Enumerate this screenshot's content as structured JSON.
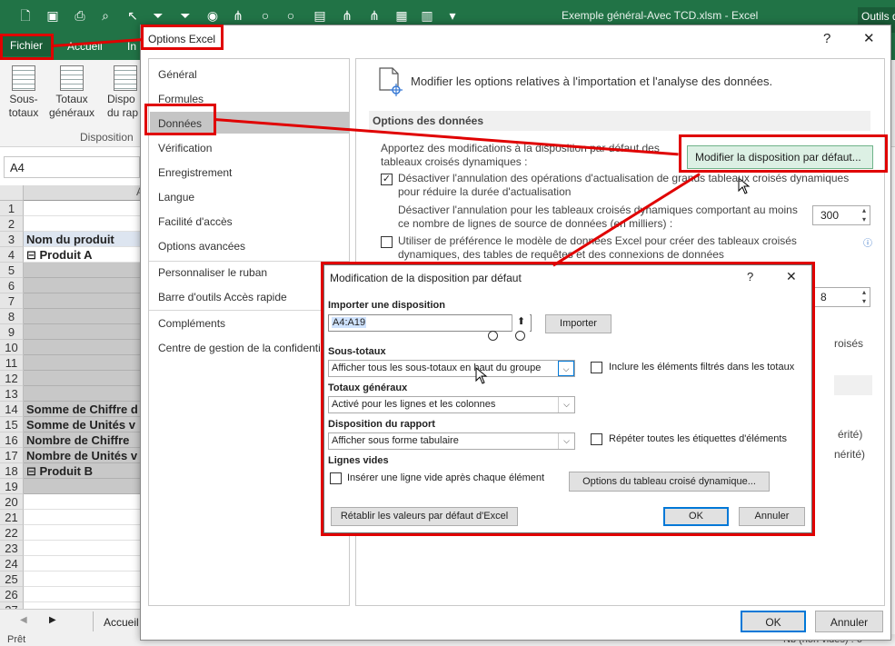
{
  "excel": {
    "window_title": "Exemple général-Avec TCD.xlsm  -  Excel",
    "tools_tab": "Outils de",
    "tabs": [
      "Fichier",
      "Accueil",
      "In"
    ],
    "ribbon": {
      "sous_totaux": "Sous-\ntotaux",
      "totaux_generaux": "Totaux\ngénéraux",
      "dispo": "Dispo\ndu rap",
      "group_label": "Disposition"
    },
    "name_box": "A4",
    "column_header": "A",
    "rows": [
      {
        "n": "1",
        "text": "",
        "style": ""
      },
      {
        "n": "2",
        "text": "",
        "style": ""
      },
      {
        "n": "3",
        "text": "Nom du produit",
        "style": "head"
      },
      {
        "n": "4",
        "text": "⊟ Produit A",
        "style": "bold"
      },
      {
        "n": "5",
        "text": "",
        "style": "grey"
      },
      {
        "n": "6",
        "text": "",
        "style": "grey"
      },
      {
        "n": "7",
        "text": "",
        "style": "grey"
      },
      {
        "n": "8",
        "text": "",
        "style": "grey"
      },
      {
        "n": "9",
        "text": "",
        "style": "grey"
      },
      {
        "n": "10",
        "text": "",
        "style": "grey"
      },
      {
        "n": "11",
        "text": "",
        "style": "grey"
      },
      {
        "n": "12",
        "text": "",
        "style": "grey"
      },
      {
        "n": "13",
        "text": "",
        "style": "grey"
      },
      {
        "n": "14",
        "text": "Somme de Chiffre d",
        "style": "grey bold"
      },
      {
        "n": "15",
        "text": "Somme de Unités v",
        "style": "grey bold"
      },
      {
        "n": "16",
        "text": "Nombre de Chiffre",
        "style": "grey bold"
      },
      {
        "n": "17",
        "text": "Nombre de Unités v",
        "style": "grey bold"
      },
      {
        "n": "18",
        "text": "⊟ Produit B",
        "style": "grey bold"
      },
      {
        "n": "19",
        "text": "",
        "style": "grey"
      },
      {
        "n": "20",
        "text": "",
        "style": ""
      },
      {
        "n": "21",
        "text": "",
        "style": ""
      },
      {
        "n": "22",
        "text": "",
        "style": ""
      },
      {
        "n": "23",
        "text": "",
        "style": ""
      },
      {
        "n": "24",
        "text": "",
        "style": ""
      },
      {
        "n": "25",
        "text": "",
        "style": ""
      },
      {
        "n": "26",
        "text": "",
        "style": ""
      },
      {
        "n": "27",
        "text": "",
        "style": ""
      }
    ],
    "sheet_tab": "Accueil",
    "status_left": "Prêt",
    "status_right": "Nb (non vides) : 6"
  },
  "options_dialog": {
    "title": "Options Excel",
    "help": "?",
    "close": "✕",
    "nav": [
      "Général",
      "Formules",
      "Données",
      "Vérification",
      "Enregistrement",
      "Langue",
      "Facilité d'accès",
      "Options avancées",
      "Personnaliser le ruban",
      "Barre d'outils Accès rapide",
      "Compléments",
      "Centre de gestion de la confidentia"
    ],
    "selected_nav": "Données",
    "header_text": "Modifier les options relatives à l'importation et l'analyse des données.",
    "section_title": "Options des données",
    "intro_text": "Apportez des modifications à la disposition par défaut des tableaux croisés dynamiques :",
    "modifier_button": "Modifier la disposition par défaut...",
    "opt1": "Désactiver l'annulation des opérations d'actualisation de grands tableaux croisés dynamiques pour réduire la durée d'actualisation",
    "opt1_checked": "✓",
    "opt2": "Désactiver l'annulation pour les tableaux croisés dynamiques comportant au moins ce nombre de lignes de source de données (en milliers) :",
    "opt2_value": "300",
    "opt3": "Utiliser de préférence le modèle de données Excel pour créer des tableaux croisés dynamiques, des tables de requêtes et des connexions de données",
    "partial_value": "8",
    "partial_text_1": "roisés",
    "partial_text_2": "érité)",
    "partial_text_3": "nérité)",
    "ok": "OK",
    "cancel": "Annuler"
  },
  "layout_dialog": {
    "title": "Modification de la disposition par défaut",
    "help": "?",
    "close": "✕",
    "import_label": "Importer une disposition",
    "import_value": "A4:A19",
    "import_button": "Importer",
    "subtotals_label": "Sous-totaux",
    "subtotals_value": "Afficher tous les sous-totaux en haut du groupe",
    "include_filtered": "Inclure les éléments filtrés dans les totaux",
    "grand_totals_label": "Totaux généraux",
    "grand_totals_value": "Activé pour les lignes et les colonnes",
    "report_layout_label": "Disposition du rapport",
    "report_layout_value": "Afficher sous forme tabulaire",
    "repeat_labels": "Répéter toutes les étiquettes d'éléments",
    "blank_rows_label": "Lignes vides",
    "blank_rows_option": "Insérer une ligne vide après chaque élément",
    "pivot_options_button": "Options du tableau croisé dynamique...",
    "reset_button": "Rétablir les valeurs par défaut d'Excel",
    "ok": "OK",
    "cancel": "Annuler"
  },
  "colors": {
    "excel_green": "#217346",
    "highlight_red": "#e00000",
    "selected_nav": "#c5c5c5",
    "modifier_button_bg": "#dcf0e4",
    "focus_blue": "#0078d7"
  }
}
